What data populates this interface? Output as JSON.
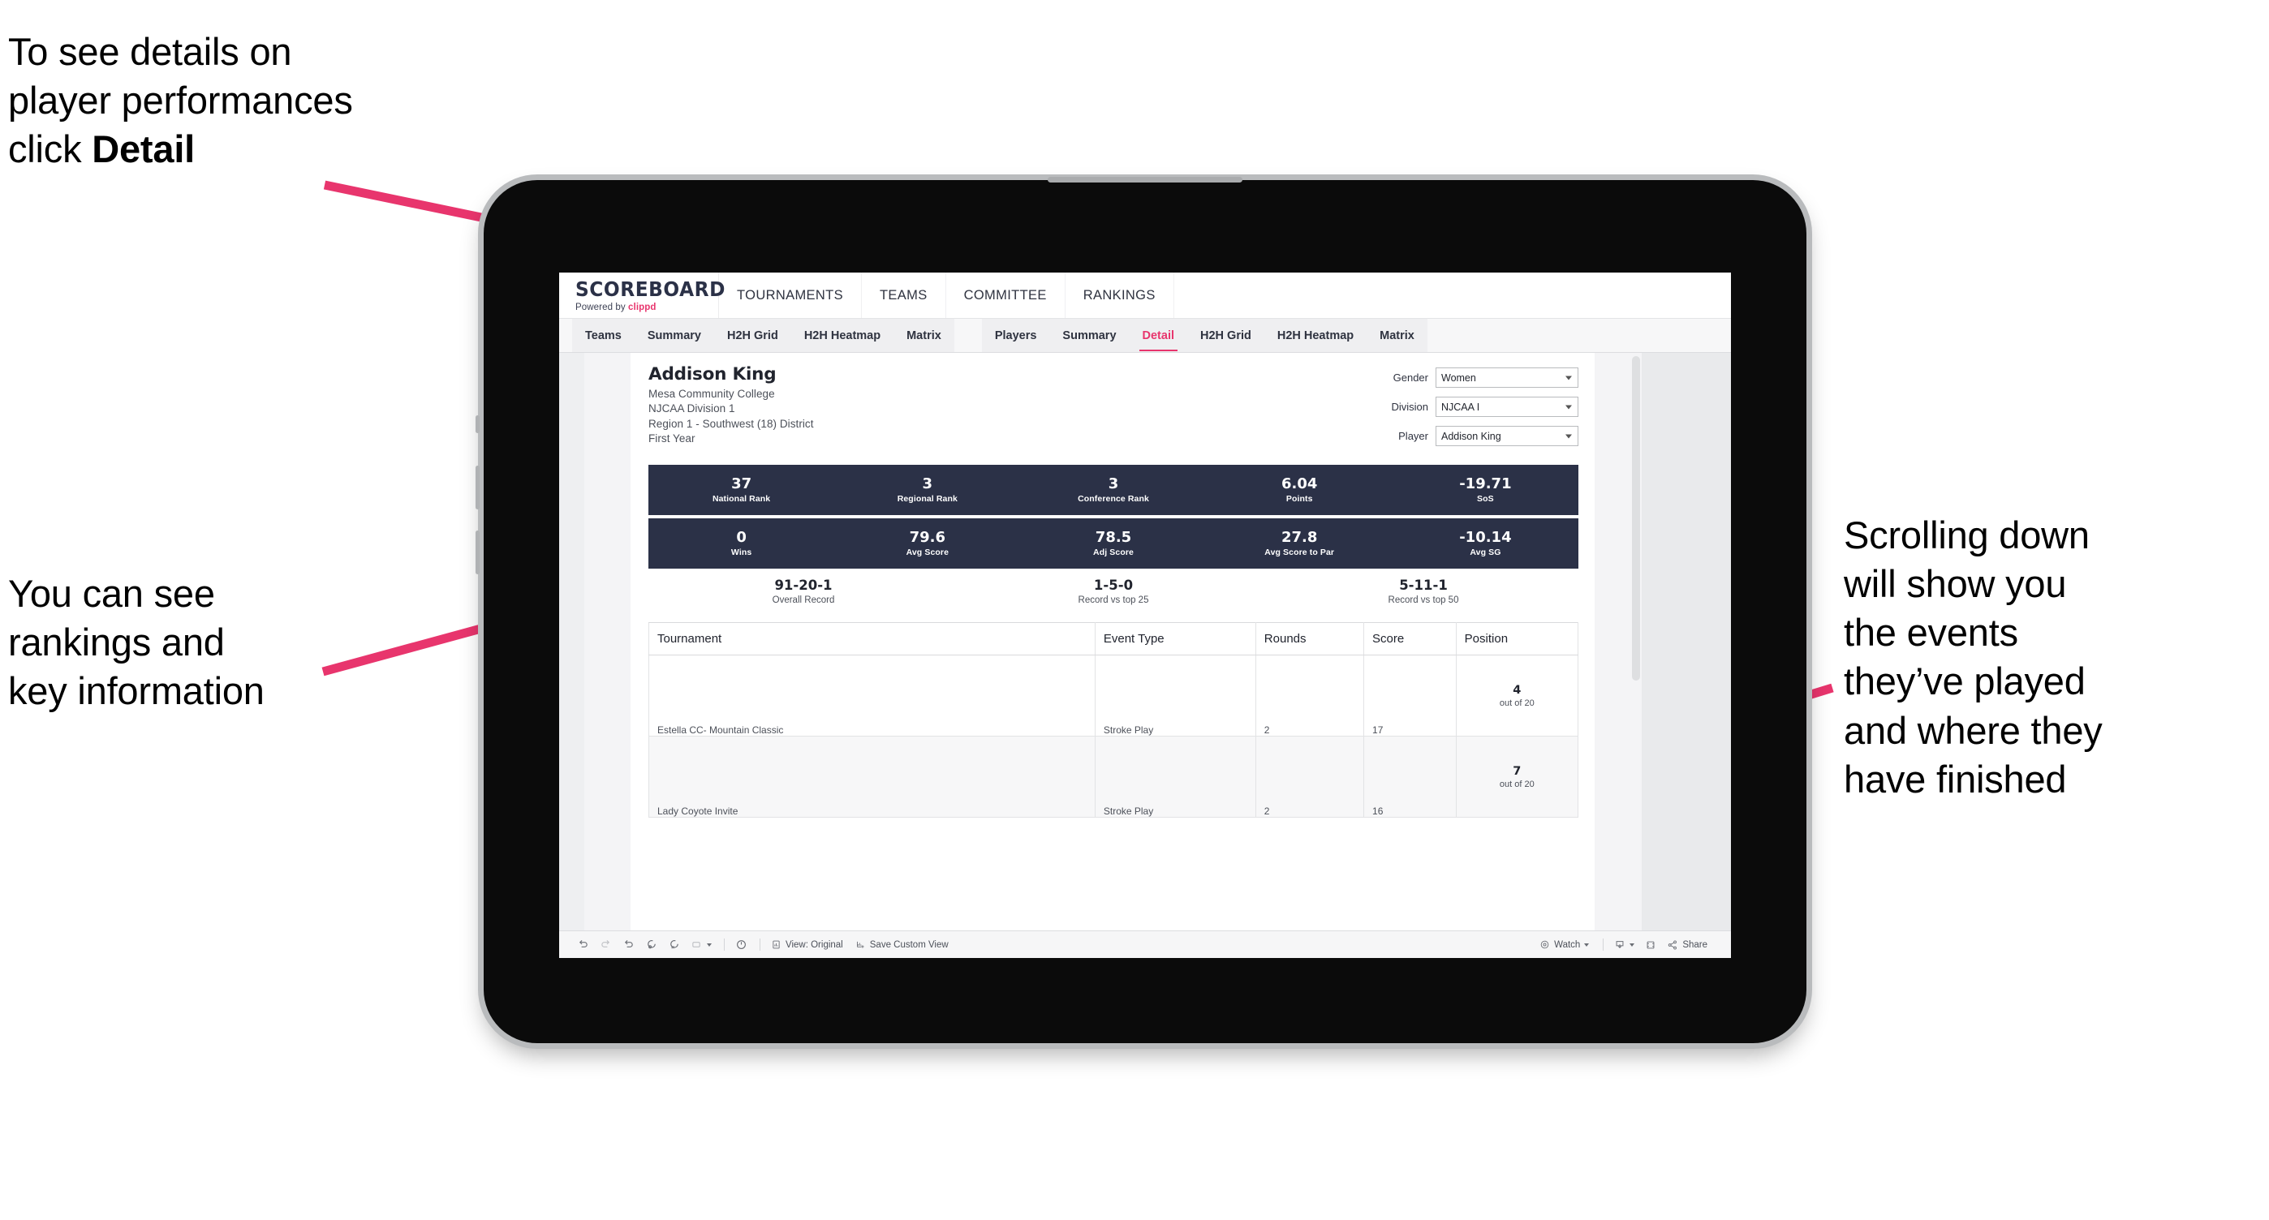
{
  "annotations": {
    "top_left": "To see details on\nplayer performances\nclick ",
    "top_left_bold": "Detail",
    "mid_left": "You can see\nrankings and\nkey information",
    "right": "Scrolling down\nwill show you\nthe events\nthey’ve played\nand where they\nhave finished",
    "arrow_color": "#E8356D"
  },
  "app": {
    "brand": {
      "title": "SCOREBOARD",
      "powered_prefix": "Powered by ",
      "powered_brand": "clippd"
    },
    "topnav": [
      "TOURNAMENTS",
      "TEAMS",
      "COMMITTEE",
      "RANKINGS"
    ],
    "tabs_left": [
      "Teams",
      "Summary",
      "H2H Grid",
      "H2H Heatmap",
      "Matrix"
    ],
    "tabs_right": [
      "Players",
      "Summary",
      "Detail",
      "H2H Grid",
      "H2H Heatmap",
      "Matrix"
    ],
    "active_tab": "Detail",
    "accent_color": "#E8356D",
    "kpi_bar_color": "#2B3147"
  },
  "player": {
    "name": "Addison King",
    "college": "Mesa Community College",
    "division": "NJCAA Division 1",
    "region": "Region 1 - Southwest (18) District",
    "year": "First Year"
  },
  "filters": [
    {
      "label": "Gender",
      "value": "Women"
    },
    {
      "label": "Division",
      "value": "NJCAA I"
    },
    {
      "label": "Player",
      "value": "Addison King"
    }
  ],
  "kpis_row1": [
    {
      "value": "37",
      "label": "National Rank"
    },
    {
      "value": "3",
      "label": "Regional Rank"
    },
    {
      "value": "3",
      "label": "Conference Rank"
    },
    {
      "value": "6.04",
      "label": "Points"
    },
    {
      "value": "-19.71",
      "label": "SoS"
    }
  ],
  "kpis_row2": [
    {
      "value": "0",
      "label": "Wins"
    },
    {
      "value": "79.6",
      "label": "Avg Score"
    },
    {
      "value": "78.5",
      "label": "Adj Score"
    },
    {
      "value": "27.8",
      "label": "Avg Score to Par"
    },
    {
      "value": "-10.14",
      "label": "Avg SG"
    }
  ],
  "records": [
    {
      "value": "91-20-1",
      "label": "Overall Record"
    },
    {
      "value": "1-5-0",
      "label": "Record vs top 25"
    },
    {
      "value": "5-11-1",
      "label": "Record vs top 50"
    }
  ],
  "table": {
    "headers": [
      "Tournament",
      "Event Type",
      "Rounds",
      "Score",
      "Position"
    ],
    "rows": [
      {
        "tournament": "Estella CC- Mountain Classic",
        "event_type": "Stroke Play",
        "rounds": "2",
        "score": "17",
        "position": "4",
        "position_sub": "out of 20"
      },
      {
        "tournament": "Lady Coyote Invite",
        "event_type": "Stroke Play",
        "rounds": "2",
        "score": "16",
        "position": "7",
        "position_sub": "out of 20"
      }
    ]
  },
  "toolbar": {
    "view_original": "View: Original",
    "save_custom_view": "Save Custom View",
    "watch": "Watch",
    "share": "Share"
  }
}
